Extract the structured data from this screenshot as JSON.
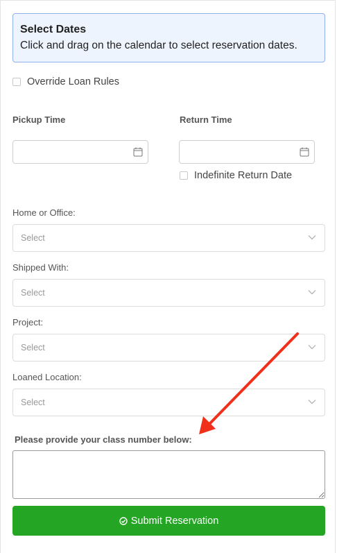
{
  "info": {
    "title": "Select Dates",
    "text": "Click and drag on the calendar to select reservation dates."
  },
  "override": {
    "label": "Override Loan Rules",
    "checked": false
  },
  "pickup": {
    "label": "Pickup Time",
    "value": ""
  },
  "return_time": {
    "label": "Return Time",
    "value": ""
  },
  "indefinite": {
    "label": "Indefinite Return Date",
    "checked": false
  },
  "fields": {
    "home_office": {
      "label": "Home or Office:",
      "value": "Select"
    },
    "shipped_with": {
      "label": "Shipped With:",
      "value": "Select"
    },
    "project": {
      "label": "Project:",
      "value": "Select"
    },
    "loaned_location": {
      "label": "Loaned Location:",
      "value": "Select"
    }
  },
  "class_number": {
    "label": "Please provide your class number below:",
    "value": ""
  },
  "submit": {
    "label": "Submit Reservation",
    "icon": "check-circle-icon"
  },
  "colors": {
    "info_bg": "#eef4fd",
    "info_border": "#8fb0e8",
    "submit_bg": "#24a524",
    "annotation_arrow": "#f0301a"
  }
}
